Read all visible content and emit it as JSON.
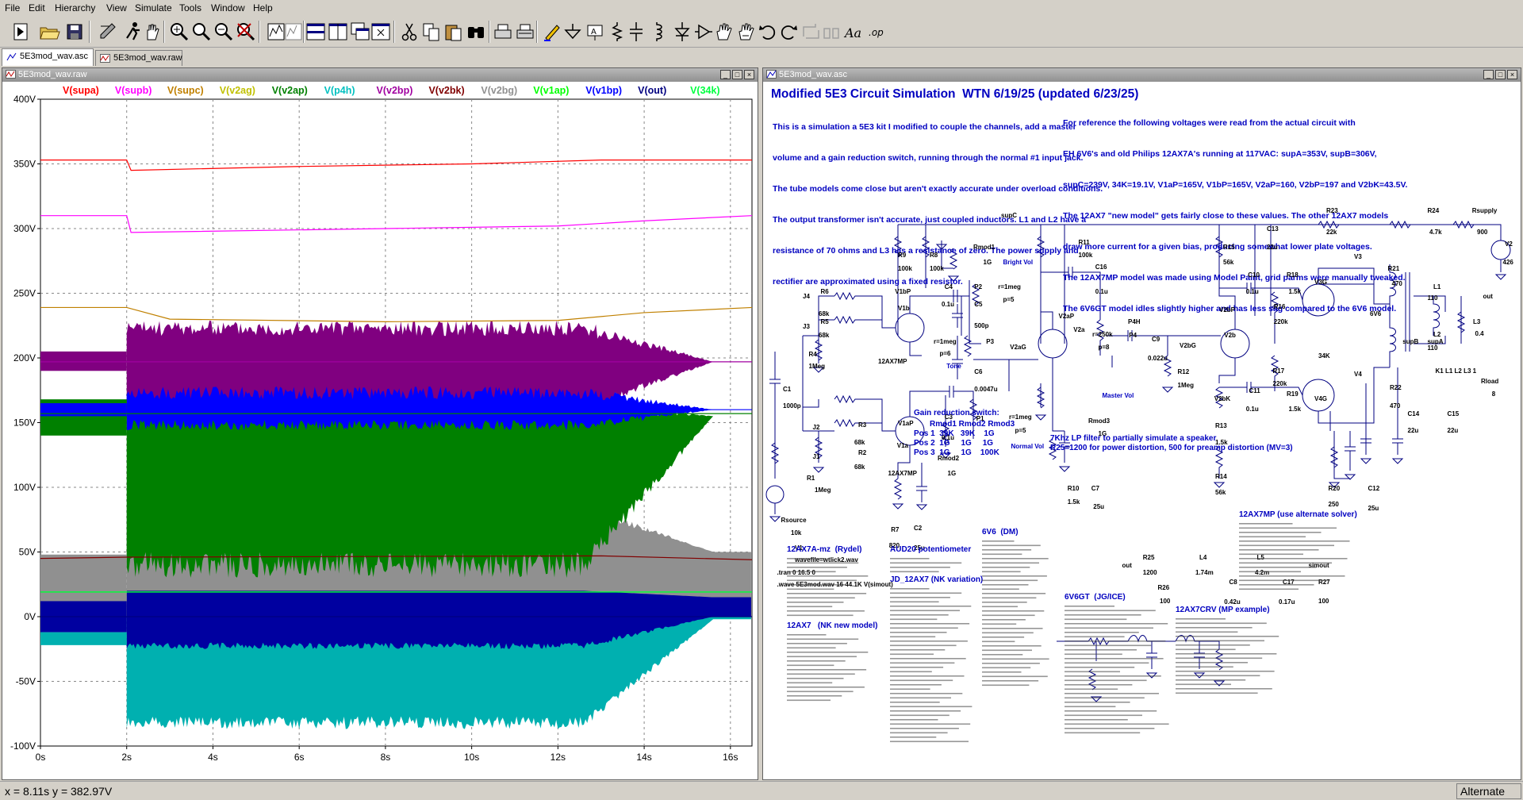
{
  "menu": [
    "File",
    "Edit",
    "Hierarchy",
    "View",
    "Simulate",
    "Tools",
    "Window",
    "Help"
  ],
  "tabs": [
    {
      "label": "5E3mod_wav.asc"
    },
    {
      "label": "5E3mod_wav.raw"
    }
  ],
  "waveform_pane": {
    "title": "5E3mod_wav.raw",
    "traces": [
      {
        "label": "V(supa)",
        "color": "#ff0000"
      },
      {
        "label": "V(supb)",
        "color": "#ff00ff"
      },
      {
        "label": "V(supc)",
        "color": "#c08000"
      },
      {
        "label": "V(v2ag)",
        "color": "#c0c000"
      },
      {
        "label": "V(v2ap)",
        "color": "#008000"
      },
      {
        "label": "V(p4h)",
        "color": "#00c0c0"
      },
      {
        "label": "V(v2bp)",
        "color": "#a000a0"
      },
      {
        "label": "V(v2bk)",
        "color": "#800000"
      },
      {
        "label": "V(v2bg)",
        "color": "#909090"
      },
      {
        "label": "V(v1ap)",
        "color": "#00ff00"
      },
      {
        "label": "V(v1bp)",
        "color": "#0000ff"
      },
      {
        "label": "V(out)",
        "color": "#000080"
      },
      {
        "label": "V(34k)",
        "color": "#00ff40"
      }
    ],
    "y_ticks": [
      "400V",
      "350V",
      "300V",
      "250V",
      "200V",
      "150V",
      "100V",
      "50V",
      "0V",
      "-50V",
      "-100V"
    ],
    "x_ticks": [
      "0s",
      "2s",
      "4s",
      "6s",
      "8s",
      "10s",
      "12s",
      "14s",
      "16s"
    ]
  },
  "chart_data": {
    "type": "line",
    "xlabel": "",
    "ylabel": "",
    "xlim": [
      0,
      16.5
    ],
    "ylim": [
      -100,
      400
    ],
    "grid": true,
    "series": [
      {
        "name": "V(supa)",
        "values": [
          {
            "x": 0,
            "y": 353
          },
          {
            "x": 2,
            "y": 353
          },
          {
            "x": 2.1,
            "y": 345
          },
          {
            "x": 6,
            "y": 348
          },
          {
            "x": 10,
            "y": 350
          },
          {
            "x": 13,
            "y": 353
          },
          {
            "x": 16.5,
            "y": 353
          }
        ]
      },
      {
        "name": "V(supb)",
        "values": [
          {
            "x": 0,
            "y": 310
          },
          {
            "x": 2,
            "y": 310
          },
          {
            "x": 2.1,
            "y": 297
          },
          {
            "x": 8,
            "y": 300
          },
          {
            "x": 12,
            "y": 302
          },
          {
            "x": 14,
            "y": 306
          },
          {
            "x": 16.5,
            "y": 310
          }
        ]
      },
      {
        "name": "V(supc)",
        "values": [
          {
            "x": 0,
            "y": 239
          },
          {
            "x": 2,
            "y": 239
          },
          {
            "x": 3,
            "y": 230
          },
          {
            "x": 8,
            "y": 228
          },
          {
            "x": 12,
            "y": 229
          },
          {
            "x": 14,
            "y": 235
          },
          {
            "x": 16.5,
            "y": 239
          }
        ]
      },
      {
        "name": "V(v2bp)",
        "values": [
          {
            "x": 0,
            "y": 197
          },
          {
            "x": 2,
            "y": 197
          },
          {
            "x": 13,
            "y": 197
          },
          {
            "x": 16.5,
            "y": 197
          }
        ]
      },
      {
        "name": "V(v1bp)",
        "values": [
          {
            "x": 0,
            "y": 160
          },
          {
            "x": 16.5,
            "y": 160
          }
        ]
      },
      {
        "name": "V(v2ap)",
        "values": [
          {
            "x": 0,
            "y": 157
          },
          {
            "x": 16.5,
            "y": 157
          }
        ]
      },
      {
        "name": "V(v2bk)",
        "values": [
          {
            "x": 0,
            "y": 45
          },
          {
            "x": 2,
            "y": 46
          },
          {
            "x": 13,
            "y": 47
          },
          {
            "x": 16.5,
            "y": 44
          }
        ]
      },
      {
        "name": "V(v1ap)",
        "values": [
          {
            "x": 0,
            "y": 19
          },
          {
            "x": 16.5,
            "y": 19
          }
        ]
      },
      {
        "name": "V(34k)",
        "values": [
          {
            "x": 0,
            "y": 19.1
          },
          {
            "x": 16.5,
            "y": 19.1
          }
        ]
      },
      {
        "name": "V(out)",
        "values": [
          {
            "x": 0,
            "y": 0
          },
          {
            "x": 16.5,
            "y": 0
          }
        ]
      }
    ]
  },
  "schematic_pane": {
    "title": "5E3mod_wav.asc",
    "heading": "Modified 5E3 Circuit Simulation  WTN 6/19/25 (updated 6/23/25)",
    "desc_left": [
      "This is a simulation a 5E3 kit I modified to couple the channels, add a master",
      "volume and a gain reduction switch, running through the normal #1 input jack.",
      "The tube models come close but aren't exactly accurate under overload conditions.",
      "The output transformer isn't accurate, just coupled inductors. L1 and L2 have a",
      "resistance of 70 ohms and L3 has a resistance of zero. The power supply and",
      "rectifier are approximated using a fixed resistor."
    ],
    "desc_right": [
      "For reference the following voltages were read from the actual circuit with",
      "EH 6V6's and old Philips 12AX7A's running at 117VAC: supA=353V, supB=306V,",
      "supC=239V, 34K=19.1V, V1aP=165V, V1bP=165V, V2aP=160, V2bP=197 and V2bK=43.5V.",
      "The 12AX7 \"new model\" gets fairly close to these values. The other 12AX7 models",
      "draw more current for a given bias, producing somewhat lower plate voltages.",
      "The 12AX7MP model was made using Model Paint, grid parms were manually tweaked.",
      "The 6V6GT model idles slightly higher and has less sag compared to the 6V6 model."
    ],
    "labels": {
      "supC": "supC",
      "R23": "R23",
      "R23v": "22k",
      "R24": "R24",
      "R24v": "4.7k",
      "Rsupply": "Rsupply",
      "Rsupplyv": "900",
      "V2": "V2",
      "V2v": "426",
      "R9": "R9",
      "R9v": "100k",
      "R8": "R8",
      "R8v": "100k",
      "Rmod1": "Rmod1",
      "Rmod1v": "1G",
      "BrightVol": "Bright Vol",
      "R11": "R11",
      "R11v": "100k",
      "R15": "R15",
      "R15v": "56k",
      "C13": "C13",
      "C13v": "22u",
      "V3": "V3",
      "R21": "R21",
      "R21v": "470",
      "L1": "L1",
      "L1v": "110",
      "out": "out",
      "L3": "L3",
      "L3v": "0.4",
      "J4": "J4",
      "R6": "R6",
      "R6v": "68k",
      "J3": "J3",
      "R5": "R5",
      "R5v": "68k",
      "V1bP": "V1bP",
      "V1b": "V1b",
      "C4": "C4",
      "C4v": "0.1u",
      "P2": "P2",
      "r1meg": "r=1meg",
      "p5": "p=5",
      "C16": "C16",
      "C16v": "0.1u",
      "V2aP": "V2aP",
      "P4H": "P4H",
      "C10": "C10",
      "C10v": "0.1u",
      "R18": "R18",
      "R18v": "1.5k",
      "V3G": "V3G",
      "R16": "R16",
      "R16v": "220k",
      "V2bP": "V2bP",
      "R4": "R4",
      "R4v": "1Meg",
      "tube1": "12AX7MP",
      "C5": "C5",
      "C5v": "500p",
      "r250k": "r=250k",
      "P4": "P4",
      "p8": "p=8",
      "C9": "C9",
      "C9v": "0.022u",
      "V2bG": "V2bG",
      "V2b": "V2b",
      "P3": "P3",
      "p6": "p=6",
      "V2aG": "V2aG",
      "V2a": "V2a",
      "Tone": "Tone",
      "C6": "C6",
      "C6v": "0.0047u",
      "R12": "R12",
      "R12v": "1Meg",
      "MasterVol": "Master Vol",
      "34K": "34K",
      "supB": "supB",
      "supA": "supA",
      "L2": "L2",
      "L2v": "110",
      "K1": "K1 L1 L2 L3 1",
      "Rload": "Rload",
      "Rloadv": "8",
      "6V6": "6V6",
      "R17": "R17",
      "R17v": "220k",
      "V2bK": "V2bK",
      "C11": "C11",
      "C11v": "0.1u",
      "R19": "R19",
      "R19v": "1.5k",
      "V4G": "V4G",
      "V4": "V4",
      "R22": "R22",
      "R22v": "470",
      "C14": "C14",
      "C14v": "22u",
      "C15": "C15",
      "C15v": "22u",
      "C1": "C1",
      "C1v": "1000p",
      "V1aP": "V1aP",
      "C3": "C3",
      "C3v": "0.1u",
      "P1": "P1",
      "Rmod3": "Rmod3",
      "Rmod3v": "1G",
      "NormalVol": "Normal Vol",
      "J2": "J2",
      "R3": "R3",
      "R3v": "68k",
      "J1": "J1",
      "R2": "R2",
      "R2v": "68k",
      "V1a": "V1a",
      "R1": "R1",
      "R1v": "1Meg",
      "Rmod2": "Rmod2",
      "Rmod2v": "1G",
      "R13": "R13",
      "R13v": "1.5k",
      "R14": "R14",
      "R14v": "56k",
      "R10": "R10",
      "R10v": "1.5k",
      "C7": "C7",
      "C7v": "25u",
      "R20": "R20",
      "R20v": "250",
      "C12": "C12",
      "C12v": "25u",
      "Rsource": "Rsource",
      "Rsourcev": "10k",
      "V1": "V1",
      "V1v": "wavefile=wtlick2.wav",
      "R7": "R7",
      "R7v": "820",
      "C2": "C2",
      "C2v": "25u",
      "GainTitle": "Gain reduction switch:",
      "GainHead": "Rmod1 Rmod2 Rmod3",
      "Pos1": "Pos 1  39K   39K    1G",
      "Pos2": "Pos 2  1G     1G     1G",
      "Pos3": "Pos 3  1G     1G    100K",
      "tran": ".tran 0 16.5 0",
      ".wave": ".wave 5E3mod.wav 16 44.1K V(simout)",
      "LP1": "7Khz LP filter to partially simulate a speaker",
      "LP2": "R25=1200 for power distortion, 500 for preamp distortion (MV=3)",
      "outlbl": "out",
      "R25": "R25",
      "R25v": "1200",
      "L4": "L4",
      "L4v": "1.74m",
      "L5": "L5",
      "L5v": "4.2m",
      "simout": "simout",
      "R26": "R26",
      "R26v": "100",
      "C8": "C8",
      "C8v": "0.42u",
      "C17": "C17",
      "C17v": "0.17u",
      "R27": "R27",
      "R27v": "100"
    },
    "models": [
      {
        "title": "12AX7A-mz  (Rydel)"
      },
      {
        "title": "AUD20 potentiometer"
      },
      {
        "title": "6V6  (DM)"
      },
      {
        "title": "12AX7MP (use alternate solver)"
      },
      {
        "title": "JD_12AX7 (NK variation)"
      },
      {
        "title": "12AX7   (NK new model)"
      },
      {
        "title": "6V6GT  (JG/ICE)"
      },
      {
        "title": "12AX7CRV (MP example)"
      }
    ]
  },
  "status": {
    "coords": "x = 8.11s   y = 382.97V",
    "solver": "Alternate"
  }
}
